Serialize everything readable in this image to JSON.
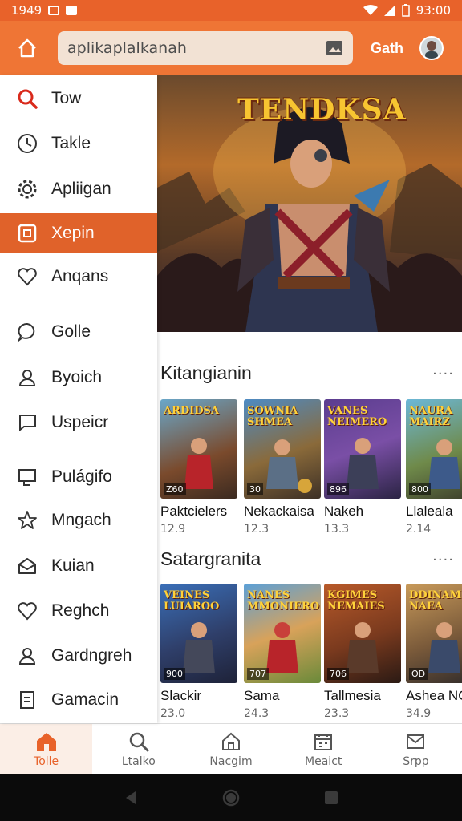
{
  "status_bar": {
    "time_left": "1949",
    "time_right": "93:00"
  },
  "app_bar": {
    "search_value": "aplikaplalkanah",
    "user_name": "Gath"
  },
  "sidebar": {
    "items": [
      {
        "label": "Tow",
        "icon": "search-icon",
        "active": false
      },
      {
        "label": "Takle",
        "icon": "clock-icon",
        "active": false
      },
      {
        "label": "Apliigan",
        "icon": "gear-icon",
        "active": false
      },
      {
        "label": "Xepin",
        "icon": "square-icon",
        "active": true
      },
      {
        "label": "Anqans",
        "icon": "heart-icon",
        "active": false
      },
      {
        "label": "Golle",
        "icon": "chat-bubble-icon",
        "active": false
      },
      {
        "label": "Byoich",
        "icon": "person-icon",
        "active": false
      },
      {
        "label": "Uspeicr",
        "icon": "message-icon",
        "active": false
      },
      {
        "label": "Pulágifo",
        "icon": "monitor-icon",
        "active": false
      },
      {
        "label": "Mngach",
        "icon": "star-icon",
        "active": false
      },
      {
        "label": "Kuian",
        "icon": "mail-open-icon",
        "active": false
      },
      {
        "label": "Reghch",
        "icon": "heart-icon",
        "active": false
      },
      {
        "label": "Gardngreh",
        "icon": "person-icon",
        "active": false
      },
      {
        "label": "Gamacin",
        "icon": "document-icon",
        "active": false
      }
    ]
  },
  "hero": {
    "title": "TENDKSA"
  },
  "sections": [
    {
      "title": "Kitangianin",
      "more": "····",
      "cards": [
        {
          "cover": "ARDIDSA",
          "badge": "Z60",
          "name": "Paktcielers",
          "rating": "12.9"
        },
        {
          "cover": "SOWNIA SHMEA",
          "badge": "30",
          "name": "Nekackaisa",
          "rating": "12.3"
        },
        {
          "cover": "VANES NEIMERO",
          "badge": "896",
          "name": "Nakeh",
          "rating": "13.3"
        },
        {
          "cover": "NAURA MAIRZ",
          "badge": "800",
          "name": "Llaleala",
          "rating": "2.14"
        }
      ]
    },
    {
      "title": "Satargranita",
      "more": "····",
      "cards": [
        {
          "cover": "VEINES LUIAROO",
          "badge": "900",
          "name": "Slackir",
          "rating": "23.0"
        },
        {
          "cover": "NANES MMONIERO",
          "badge": "707",
          "name": "Sama",
          "rating": "24.3"
        },
        {
          "cover": "KGIMES NEMAIES",
          "badge": "706",
          "name": "Tallmesia",
          "rating": "23.3"
        },
        {
          "cover": "DDINAM NAEA",
          "badge": "OD",
          "name": "Ashea NO",
          "rating": "34.9"
        }
      ]
    }
  ],
  "bottom_nav": [
    {
      "label": "Tolle",
      "icon": "home-icon",
      "active": true
    },
    {
      "label": "Ltalko",
      "icon": "search-icon",
      "active": false
    },
    {
      "label": "Nacgim",
      "icon": "house-icon",
      "active": false
    },
    {
      "label": "Meaict",
      "icon": "calendar-icon",
      "active": false
    },
    {
      "label": "Srpp",
      "icon": "mail-icon",
      "active": false
    }
  ],
  "colors": {
    "accent": "#e8622a",
    "app_bar": "#ef7535",
    "active_item": "#e0622a"
  }
}
